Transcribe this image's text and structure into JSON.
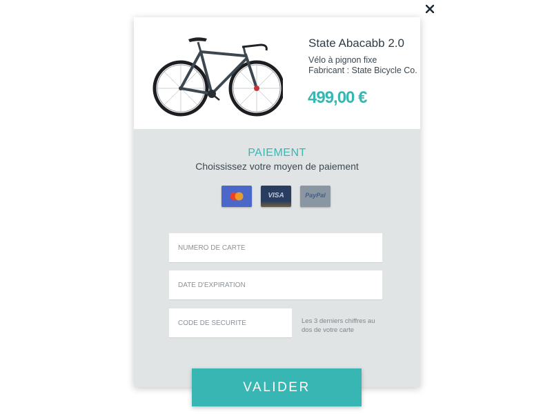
{
  "product": {
    "name": "State Abacabb 2.0",
    "type": "Vélo à pignon fixe",
    "maker": "Fabricant : State Bicycle Co.",
    "price": "499,00 €",
    "image_icon": "fixie-bicycle-image"
  },
  "payment": {
    "title": "PAIEMENT",
    "subtitle": "Choississez votre moyen de paiement",
    "methods": [
      {
        "name": "mastercard",
        "icon": "mastercard-icon"
      },
      {
        "name": "visa",
        "label": "VISA",
        "icon": "visa-icon"
      },
      {
        "name": "paypal",
        "label": "PayPal",
        "icon": "paypal-icon"
      }
    ]
  },
  "form": {
    "card_number": {
      "value": "",
      "placeholder": "NUMÉRO DE CARTE"
    },
    "expiration": {
      "value": "",
      "placeholder": "DATE D'EXPIRATION"
    },
    "security_code": {
      "value": "",
      "placeholder": "CODE DE SÉCURITÉ"
    },
    "security_hint": "Les 3 derniers chiffres au dos de votre carte"
  },
  "actions": {
    "submit_label": "VALIDER",
    "close_icon": "close-icon"
  },
  "colors": {
    "accent": "#37b6b2",
    "panel_bg": "#e1e4e5",
    "text_dark": "#2f3b45",
    "mastercard_blue": "#4a67c9",
    "visa_navy": "#283d60",
    "paypal_gray": "#8b96a3"
  }
}
